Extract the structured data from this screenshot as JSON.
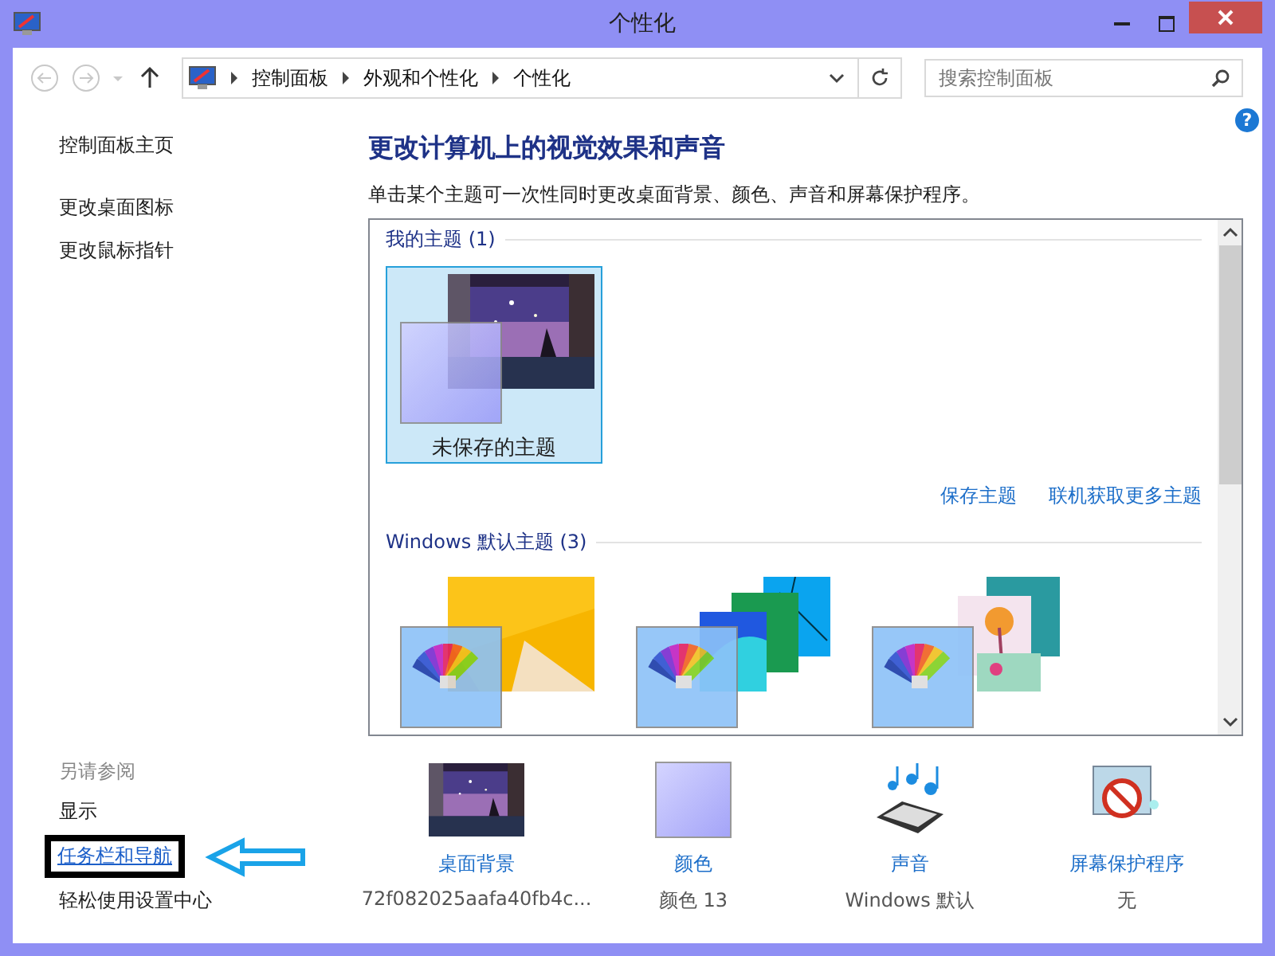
{
  "window": {
    "title": "个性化"
  },
  "nav": {
    "breadcrumb": [
      "控制面板",
      "外观和个性化",
      "个性化"
    ],
    "search": {
      "placeholder": "搜索控制面板"
    },
    "help": "?"
  },
  "sidebar": {
    "links": [
      {
        "label": "控制面板主页"
      },
      {
        "label": "更改桌面图标"
      },
      {
        "label": "更改鼠标指针"
      }
    ],
    "see_also_title": "另请参阅",
    "see_also": [
      {
        "label": "显示",
        "highlighted": false
      },
      {
        "label": "任务栏和导航",
        "highlighted": true
      },
      {
        "label": "轻松使用设置中心",
        "highlighted": false
      }
    ]
  },
  "heading": "更改计算机上的视觉效果和声音",
  "description": "单击某个主题可一次性同时更改桌面背景、颜色、声音和屏幕保护程序。",
  "theme_groups": [
    {
      "title": "我的主题",
      "count": "(1)",
      "themes": [
        {
          "name": "未保存的主题",
          "selected": true,
          "kind": "night"
        }
      ],
      "actions": [
        "保存主题",
        "联机获取更多主题"
      ]
    },
    {
      "title": "Windows 默认主题",
      "count": "(3)",
      "themes": [
        {
          "selected": false,
          "kind": "yellow"
        },
        {
          "selected": false,
          "kind": "lines"
        },
        {
          "selected": false,
          "kind": "flowers"
        }
      ]
    }
  ],
  "bottom_items": [
    {
      "label": "桌面背景",
      "value": "72f082025aafa40fb4c...",
      "kind": "wallpaper"
    },
    {
      "label": "颜色",
      "value": "颜色 13",
      "kind": "color"
    },
    {
      "label": "声音",
      "value": "Windows 默认",
      "kind": "sound"
    },
    {
      "label": "屏幕保护程序",
      "value": "无",
      "kind": "screensaver"
    }
  ]
}
